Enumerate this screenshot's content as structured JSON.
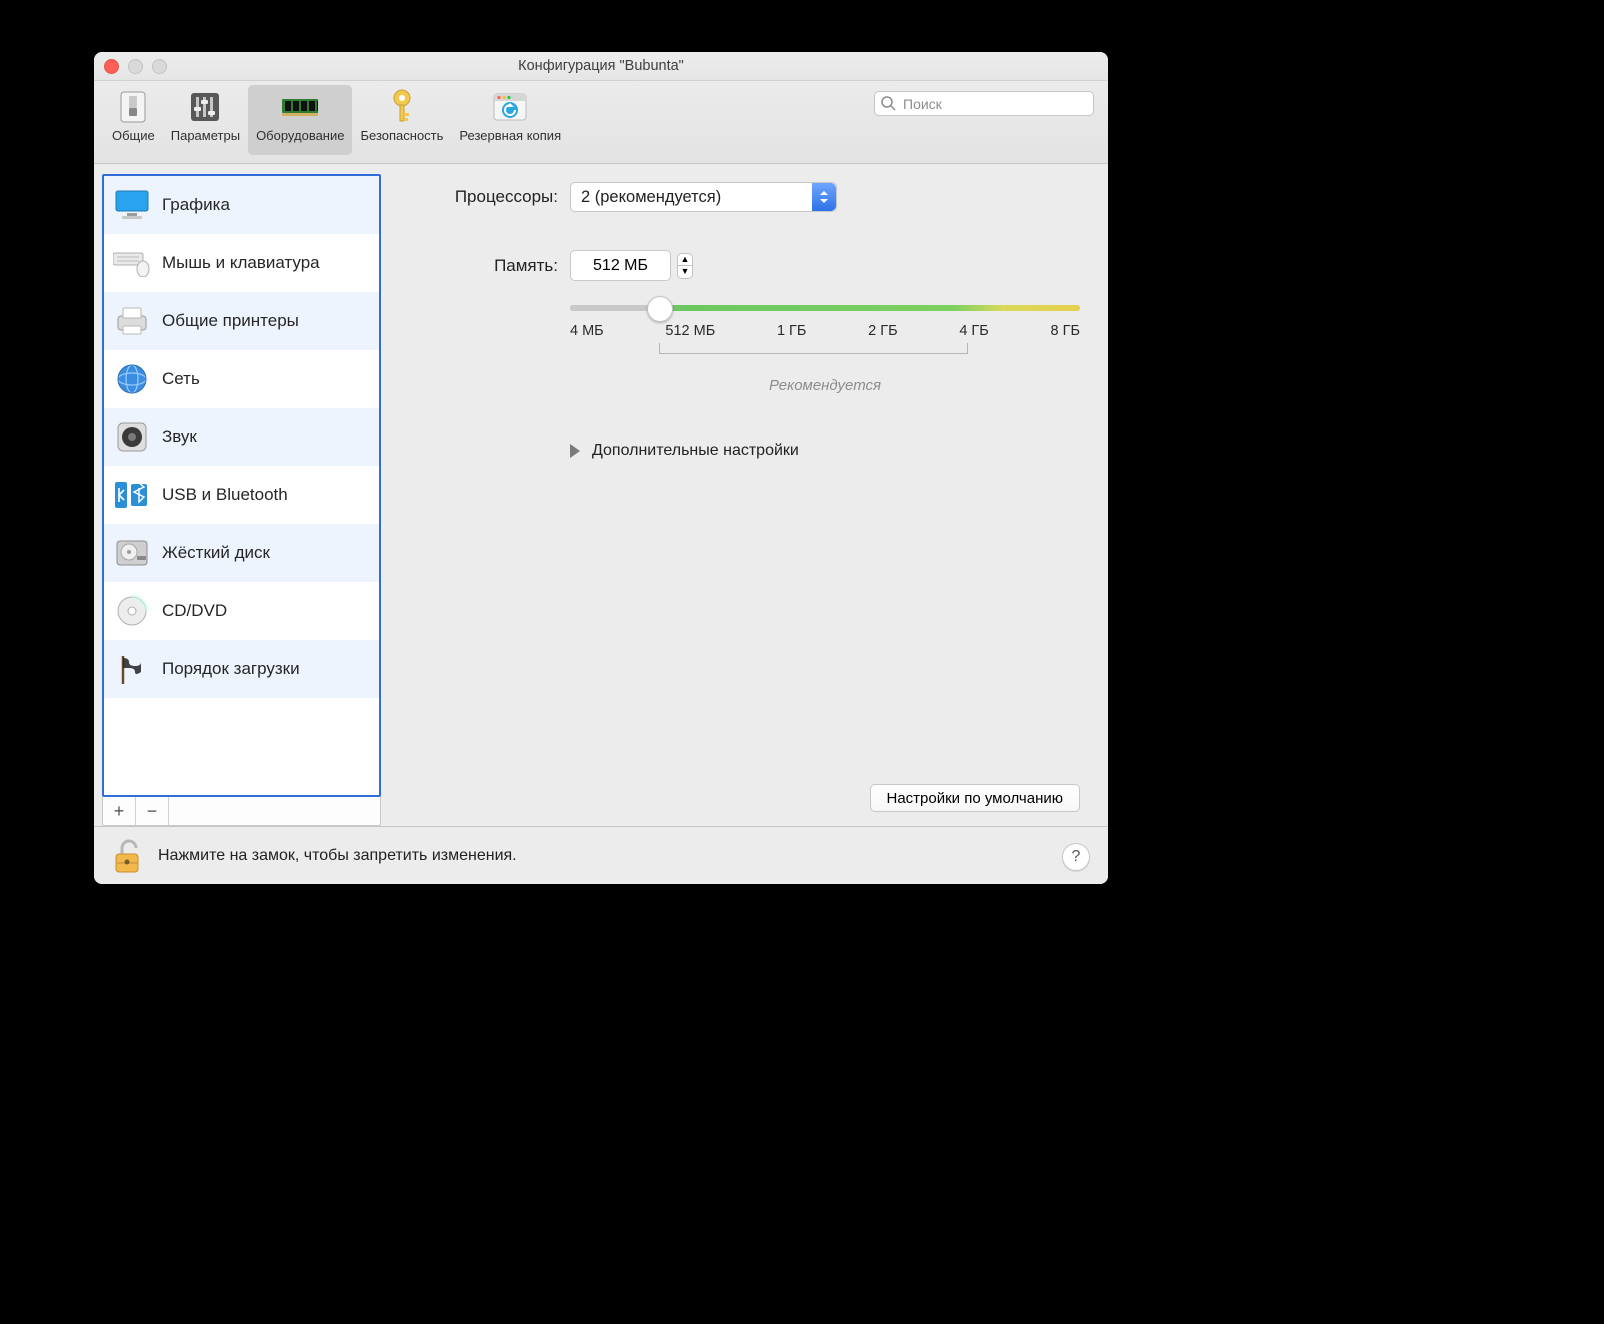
{
  "window": {
    "title": "Конфигурация \"Bubunta\""
  },
  "toolbar": {
    "items": [
      {
        "label": "Общие"
      },
      {
        "label": "Параметры"
      },
      {
        "label": "Оборудование"
      },
      {
        "label": "Безопасность"
      },
      {
        "label": "Резервная копия"
      }
    ],
    "search_placeholder": "Поиск"
  },
  "sidebar": {
    "items": [
      {
        "label": "Графика"
      },
      {
        "label": "Мышь и клавиатура"
      },
      {
        "label": "Общие принтеры"
      },
      {
        "label": "Сеть"
      },
      {
        "label": "Звук"
      },
      {
        "label": "USB и Bluetooth"
      },
      {
        "label": "Жёсткий диск"
      },
      {
        "label": "CD/DVD"
      },
      {
        "label": "Порядок загрузки"
      }
    ],
    "add_label": "+",
    "remove_label": "−"
  },
  "main": {
    "cpu_label": "Процессоры:",
    "cpu_value": "2 (рекомендуется)",
    "mem_label": "Память:",
    "mem_value": "512 МБ",
    "slider_ticks": [
      "4 МБ",
      "512 МБ",
      "1 ГБ",
      "2 ГБ",
      "4 ГБ",
      "8 ГБ"
    ],
    "recommended_label": "Рекомендуется",
    "advanced_label": "Дополнительные настройки",
    "defaults_label": "Настройки по умолчанию"
  },
  "footer": {
    "lock_text": "Нажмите на замок, чтобы запретить изменения.",
    "help": "?"
  }
}
